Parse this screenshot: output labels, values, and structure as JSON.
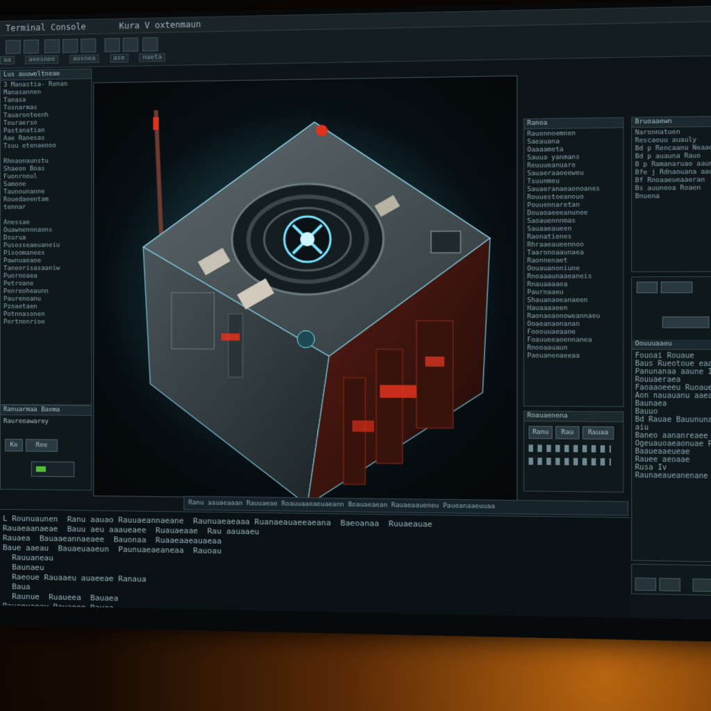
{
  "window": {
    "title": "Terminal Console",
    "document_title": "Kura V oxtenmaun"
  },
  "tabs": [
    "aa",
    "aeesnee",
    "ausnea",
    "ase",
    "naeta"
  ],
  "left_panel": {
    "header": "Lus auuweltneae",
    "lines": [
      "3 Manastia- Ronan",
      "Manasannen",
      "Tanasa",
      "Tosnarmas",
      "Tauaronteenh",
      "Teuraerso",
      "Pastanatian",
      "Aae Ranesas",
      "Tsuu etenaeooo",
      "",
      "Rhnaonaunstu",
      "Shaeon Boas",
      "Fuonrnoul",
      "Samooe",
      "Taunounanne",
      "Rouedaeentam",
      "tennar",
      "",
      "Anessae",
      "Ouawnennnaons",
      "Dsurua",
      "Pusosseaeuaneiu",
      "Pisoomanees",
      "Pawnuaeaoe",
      "Taneorisasaaniw",
      "Puornoaea",
      "Petroane",
      "Penreoheaunn",
      "Paurenoanu",
      "Pzoaetaen",
      "Potnnasonen",
      "Pertnonrioe"
    ],
    "footer": "Ranuarmaa Baoma",
    "sub_header": "Raureoawarey",
    "controls": [
      "Ko",
      "Roe"
    ]
  },
  "right_list_panel": {
    "header": "Ranoa",
    "lines": [
      "Rauonnoemnen",
      "Saeauana",
      "Oaaaameta",
      "Sauua yanmans",
      "Reuuueanuare",
      "Sauaeraaoeeweu",
      "Tsuunmeu",
      "Sauaeranaeaonoanes",
      "Rouuestoeanouo",
      "Pouuennaretan",
      "Douaoaeeeanunee",
      "Saoauennnmas",
      "Sauaaeaueen",
      "Raonatienes",
      "Rhraaeaueennoo",
      "Taaronoaaunaea",
      "Raonnenaet",
      "Oouauanoniune",
      "Rnoaaaunaaeaneis",
      "Rnauaaaaoa",
      "Paurnaaeu",
      "Shauanaoeanaeen",
      "Hauaaaaeen",
      "Raonaoaonoweannaeu",
      "Ooaeanaonanan",
      "Fooouuaeaane",
      "Foauueeaoennanea",
      "Rnooaauaun",
      "Paouanenaeeaa"
    ]
  },
  "far_right_panel": {
    "header": "Bruoaaewn",
    "lines": [
      "Naronnatuen",
      "Rescaouu auauly",
      "Bd p Rencaanu Neaao",
      "Bd p auauna Rauo",
      "B p Ramanaruao aaune",
      "Bfe j Rdnaouana aaun",
      "Bf Rnoaaeueaaeran",
      "Bs auuneoa Roaen",
      "Bnuena"
    ],
    "lower_header": "Oouuuaaeu",
    "lower_lines": [
      "Fouoai Rouaue",
      "Baus Rueotoue eaalo",
      "Panunanaa aaune Iaea",
      "Rouuaeraea",
      "Faoaaoeeeu Ruoaueuaeoe",
      "Aon nauauanu aaeaua",
      "Baunaea",
      "Bauuo",
      "Bd Rauae Bauununaaeue",
      "aiu",
      "Baneo aananreaee",
      "Ogeuauoaeaonuae Raeuae",
      "Baaueaaeueae",
      "Rauee aeoaae",
      "Rusa Iv",
      "Raunaeaueanenane"
    ]
  },
  "small_panel": {
    "header": "Roauaenena",
    "buttons": [
      "Ranu",
      "Rau",
      "Rauaa"
    ]
  },
  "statusbar": {
    "text": "Ranu aauaeaaan  Rauuaeae  Roauuaaeaeuaeann  Boauaeaean  Rauaeaaueneu  Paueanaaeuuaa"
  },
  "console": {
    "lines": [
      "L Rounuaunen  Ranu aauao Rauuaeannaeane  Raunuaeaeaaa Ruanaeauaeeaeana  Baeoanaa  Ruuaeauae",
      "Rauaeaanaeae  Bauu aeu aaaueaee  Ruauaeaae  Rau aauaaeu",
      "Rauaea  Bauaaeannaeaee  Bauonaa  Ruaaeaaeauaeaa",
      "Baue aaeau  Bauaeuaaeun  Paunuaeaeaneaa  Rauoau",
      "  Rauuaneau",
      "  Baunaeu",
      "  Raeoue Rauaaeu auaeeae Ranaua",
      "  Baua",
      "  Raunue  Ruaueea  Bauaea",
      "Rauanuaeau Rauaeoe Rauaa"
    ]
  },
  "colors": {
    "accent_red": "#e0331f",
    "accent_cyan": "#79e3ff",
    "panel_bg": "#0f181b"
  }
}
